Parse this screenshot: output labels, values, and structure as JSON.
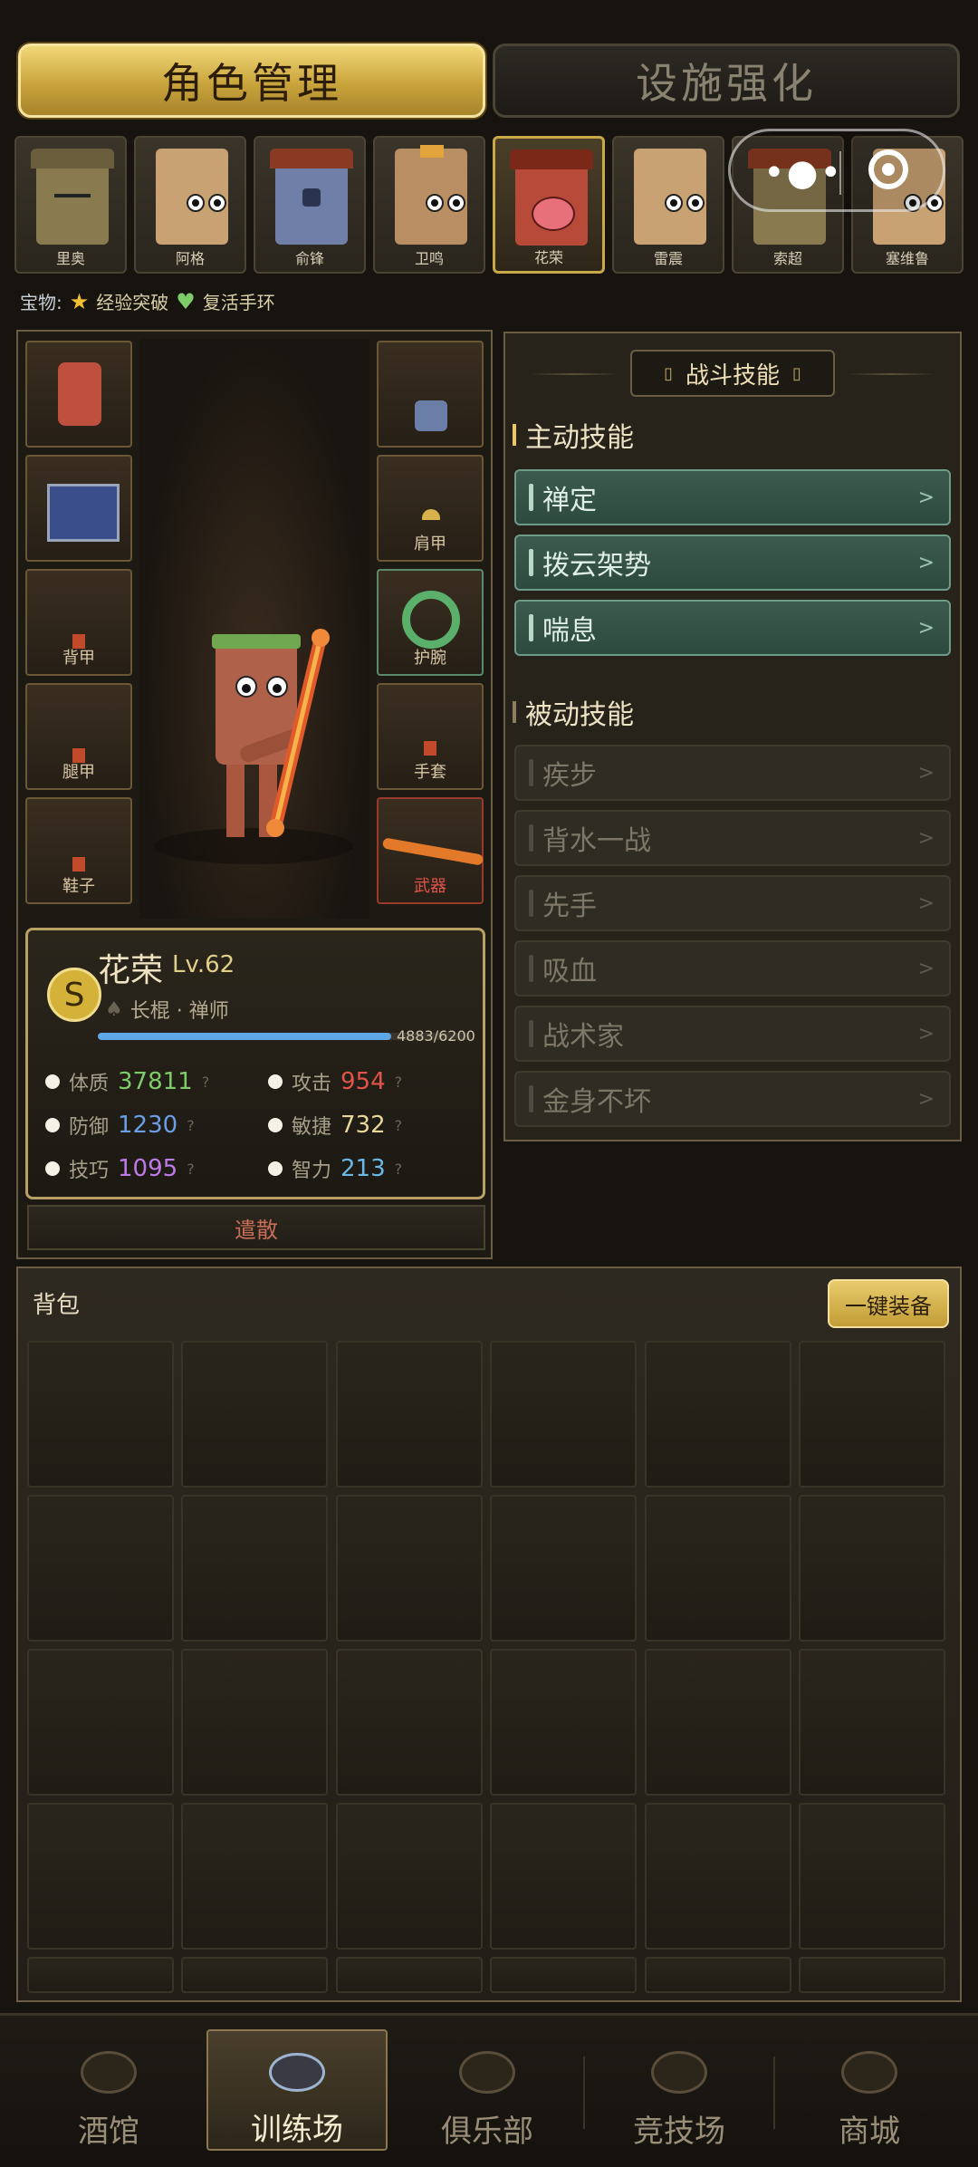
{
  "top_tabs": {
    "role": "角色管理",
    "facility": "设施强化"
  },
  "characters": [
    {
      "name": "里奥",
      "selected": false
    },
    {
      "name": "阿格",
      "selected": false
    },
    {
      "name": "俞锋",
      "selected": false
    },
    {
      "name": "卫鸣",
      "selected": false
    },
    {
      "name": "花荣",
      "selected": true
    },
    {
      "name": "雷震",
      "selected": false
    },
    {
      "name": "索超",
      "selected": false
    },
    {
      "name": "塞维鲁",
      "selected": false
    }
  ],
  "treasure": {
    "label": "宝物:",
    "item1": "经验突破",
    "item2": "复活手环"
  },
  "equipment": {
    "back": "背甲",
    "legs": "腿甲",
    "shoes": "鞋子",
    "shoulder": "肩甲",
    "wrist": "护腕",
    "gloves": "手套",
    "weapon": "武器"
  },
  "hero": {
    "rank": "S",
    "name": "花荣",
    "level": "Lv.62",
    "class": "长棍 · 禅师",
    "xp_text": "4883/6200",
    "xp_fraction": 0.7876,
    "stats": {
      "con_label": "体质",
      "con_value": "37811",
      "atk_label": "攻击",
      "atk_value": "954",
      "def_label": "防御",
      "def_value": "1230",
      "agi_label": "敏捷",
      "agi_value": "732",
      "skl_label": "技巧",
      "skl_value": "1095",
      "int_label": "智力",
      "int_value": "213",
      "help": "?"
    },
    "dismiss": "遣散"
  },
  "skills": {
    "title": "战斗技能",
    "active_title": "主动技能",
    "passive_title": "被动技能",
    "active": [
      "禅定",
      "拨云架势",
      "喘息"
    ],
    "passive": [
      "疾步",
      "背水一战",
      "先手",
      "吸血",
      "战术家",
      "金身不坏"
    ],
    "arrow": ">"
  },
  "backpack": {
    "title": "背包",
    "equip_all": "一键装备"
  },
  "nav": {
    "tavern": "酒馆",
    "training": "训练场",
    "club": "俱乐部",
    "arena": "竞技场",
    "shop": "商城"
  },
  "colors": {
    "gold": "#d4b23a",
    "hp_green": "#7ecb6a",
    "atk_red": "#e0544a",
    "def_blue": "#6a9ee6",
    "agi_yellow": "#e8d69a",
    "skl_purple": "#c07ae8",
    "int_blue": "#6ab8e8",
    "xp_blue": "#5fa6e6"
  }
}
